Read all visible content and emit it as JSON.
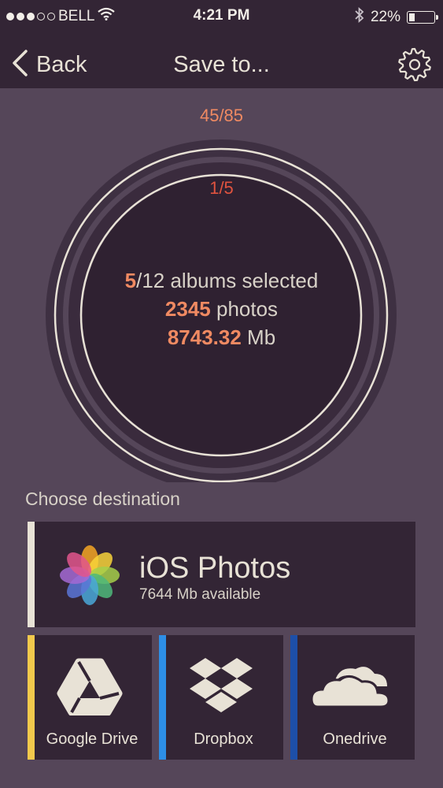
{
  "status_bar": {
    "carrier": "BELL",
    "time": "4:21 PM",
    "battery": "22%",
    "battery_level": 0.22,
    "signal_bars": 3,
    "signal_total": 5
  },
  "nav": {
    "back_label": "Back",
    "title": "Save to..."
  },
  "progress": {
    "outer_label": "45/85",
    "outer_fraction": 0.53,
    "inner_label": "1/5",
    "inner_fraction": 0.2,
    "albums_selected": "5",
    "albums_total_text": "/12 albums selected",
    "photos_count": "2345",
    "photos_suffix": " photos",
    "size_value": "8743.32",
    "size_unit": " Mb"
  },
  "destinations": {
    "section_label": "Choose destination",
    "primary": {
      "name": "iOS Photos",
      "available": "7644 Mb available",
      "accent": "#e8e2d6"
    },
    "tiles": [
      {
        "name": "Google Drive",
        "accent": "#f2c94c",
        "icon": "google-drive-icon"
      },
      {
        "name": "Dropbox",
        "accent": "#2d8ee6",
        "icon": "dropbox-icon"
      },
      {
        "name": "Onedrive",
        "accent": "#1d4fa8",
        "icon": "onedrive-icon"
      }
    ]
  },
  "colors": {
    "background": "#554659",
    "bar": "#332535",
    "accent_orange": "#f08a62",
    "accent_red": "#e0533f",
    "cream": "#e8e2d6"
  }
}
